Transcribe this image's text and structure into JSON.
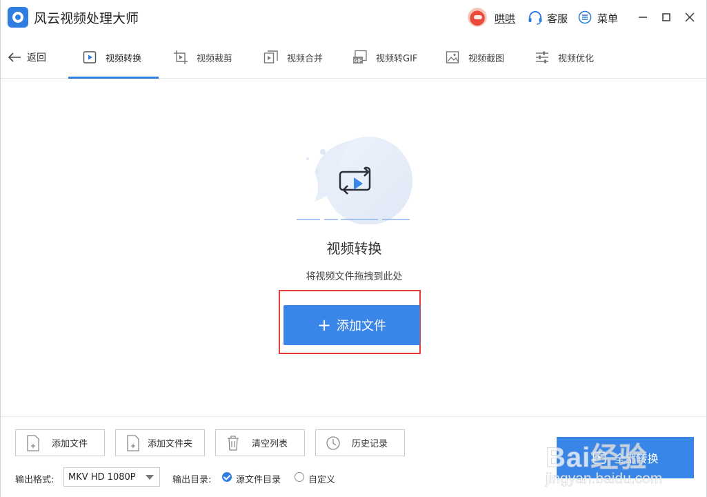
{
  "app": {
    "title": "风云视频处理大师"
  },
  "titlebar": {
    "username": "哄哄",
    "customer_service": "客服",
    "menu": "菜单"
  },
  "nav": {
    "back_label": "返回",
    "tabs": [
      {
        "label": "视频转换",
        "icon": "video-convert-icon",
        "active": true
      },
      {
        "label": "视频裁剪",
        "icon": "video-crop-icon",
        "active": false
      },
      {
        "label": "视频合并",
        "icon": "video-merge-icon",
        "active": false
      },
      {
        "label": "视频转GIF",
        "icon": "gif-icon",
        "active": false
      },
      {
        "label": "视频截图",
        "icon": "screenshot-icon",
        "active": false
      },
      {
        "label": "视频优化",
        "icon": "optimize-icon",
        "active": false
      }
    ]
  },
  "main": {
    "title": "视频转换",
    "hint": "将视频文件拖拽到此处",
    "add_file_button": "添加文件"
  },
  "bottom": {
    "buttons": [
      {
        "label": "添加文件",
        "icon": "add-file-icon"
      },
      {
        "label": "添加文件夹",
        "icon": "add-folder-icon"
      },
      {
        "label": "清空列表",
        "icon": "trash-icon"
      },
      {
        "label": "历史记录",
        "icon": "history-icon"
      }
    ],
    "output_format_label": "输出格式:",
    "output_format_value": "MKV HD 1080P",
    "output_dir_label": "输出目录:",
    "output_dir_options": [
      {
        "label": "源文件目录",
        "selected": true
      },
      {
        "label": "自定义",
        "selected": false
      }
    ],
    "convert_all_button": "全部转换"
  },
  "watermark": {
    "brand": "Bai经验",
    "url": "jingyan.baidu.com"
  },
  "colors": {
    "accent": "#3a86e8",
    "highlight": "#e53935"
  }
}
